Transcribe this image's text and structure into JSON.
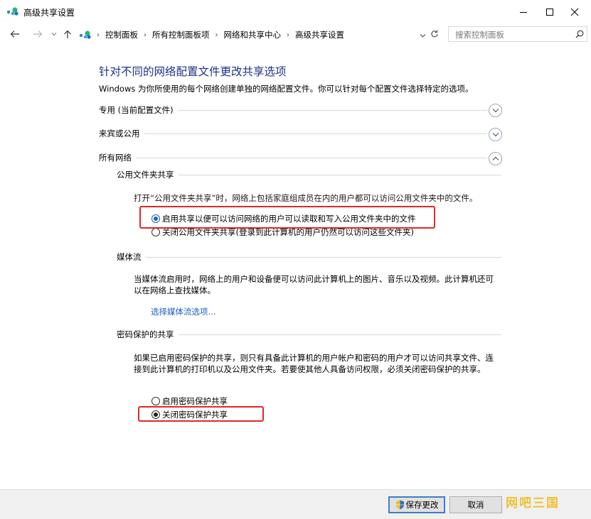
{
  "window": {
    "title": "高级共享设置"
  },
  "nav": {
    "breadcrumbs": [
      "控制面板",
      "所有控制面板项",
      "网络和共享中心",
      "高级共享设置"
    ],
    "search_placeholder": "搜索控制面板"
  },
  "content": {
    "heading": "针对不同的网络配置文件更改共享选项",
    "description": "Windows 为你所使用的每个网络创建单独的网络配置文件。你可以针对每个配置文件选择特定的选项。",
    "profiles": [
      {
        "label": "专用 (当前配置文件)",
        "expanded": false
      },
      {
        "label": "来宾或公用",
        "expanded": false
      },
      {
        "label": "所有网络",
        "expanded": true
      }
    ],
    "public_folder": {
      "title": "公用文件夹共享",
      "text": "打开“公用文件夹共享”时，网络上包括家庭组成员在内的用户都可以访问公用文件夹中的文件。",
      "option_on": "启用共享以便可以访问网络的用户可以读取和写入公用文件夹中的文件",
      "option_off": "关闭公用文件夹共享(登录到此计算机的用户仍然可以访问这些文件夹)",
      "selected": "on"
    },
    "media": {
      "title": "媒体流",
      "text": "当媒体流启用时，网络上的用户和设备便可以访问此计算机上的图片、音乐以及视频。此计算机还可以在网络上查找媒体。",
      "link": "选择媒体流选项..."
    },
    "password": {
      "title": "密码保护的共享",
      "text": "如果已启用密码保护的共享，则只有具备此计算机的用户帐户和密码的用户才可以访问共享文件、连接到此计算机的打印机以及公用文件夹。若要使其他人具备访问权限，必须关闭密码保护的共享。",
      "option_on": "启用密码保护共享",
      "option_off": "关闭密码保护共享",
      "selected": "off"
    }
  },
  "footer": {
    "save_label": "保存更改",
    "cancel_label": "取消"
  },
  "watermark": "网吧三国",
  "colors": {
    "heading": "#1e3287",
    "link": "#1a5fc6",
    "highlight_box": "#e02828"
  }
}
